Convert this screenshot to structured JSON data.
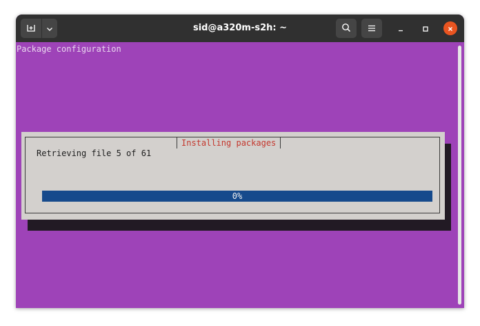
{
  "window": {
    "title": "sid@a320m-s2h: ~"
  },
  "titlebar": {
    "icons": {
      "new_tab": "new-tab-icon",
      "tab_menu": "chevron-down-icon",
      "search": "search-icon",
      "menu": "hamburger-menu-icon",
      "minimize": "minimize-icon",
      "maximize": "maximize-icon",
      "close": "close-icon"
    }
  },
  "terminal": {
    "backtitle": "Package configuration",
    "dialog": {
      "title": "Installing packages",
      "message": "Retrieving file 5 of 61",
      "progress": {
        "percent": 0,
        "label": "0%"
      }
    }
  },
  "colors": {
    "terminal_background": "#9e43b8",
    "titlebar": "#303030",
    "close_button": "#e95420",
    "dialog_background": "#d3d0cd",
    "dialog_title": "#c4372d",
    "progress_bar": "#164a8c"
  }
}
